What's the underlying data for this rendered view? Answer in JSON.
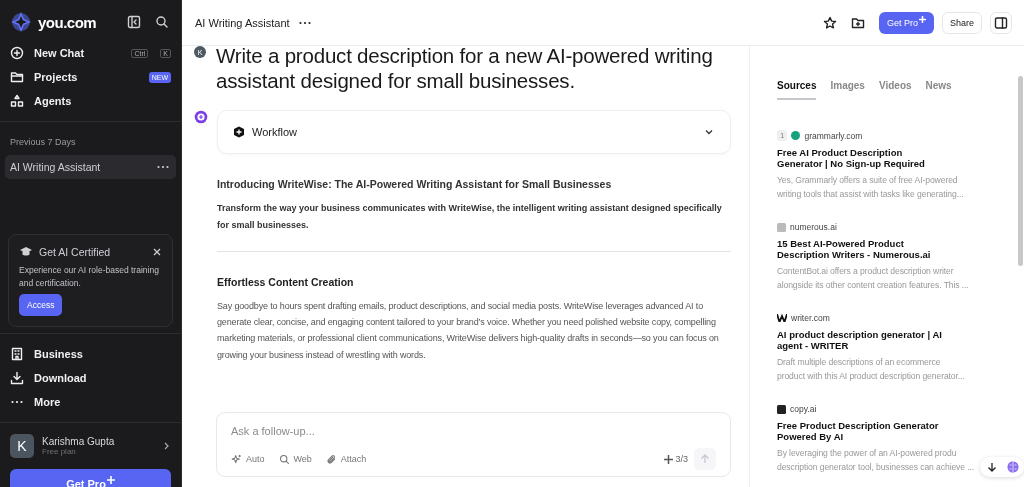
{
  "sidebar": {
    "brand": "you.com",
    "nav": [
      {
        "kind": "new",
        "label": "New Chat",
        "keys": [
          "Ctrl",
          "K"
        ]
      },
      {
        "kind": "projects",
        "label": "Projects",
        "badge": "NEW"
      },
      {
        "kind": "agents",
        "label": "Agents"
      }
    ],
    "history_heading": "Previous 7 Days",
    "history": [
      {
        "label": "AI Writing Assistant",
        "selected": true
      }
    ],
    "promo": {
      "title": "Get AI Certified",
      "text": "Experience our AI role-based training and certification.",
      "button": "Access"
    },
    "bottom_nav": [
      {
        "kind": "business",
        "label": "Business"
      },
      {
        "kind": "download",
        "label": "Download"
      },
      {
        "kind": "more",
        "label": "More"
      }
    ],
    "user": {
      "initial": "K",
      "name": "Karishma Gupta",
      "plan": "Free plan"
    },
    "upgrade": "Get Pro"
  },
  "header": {
    "title": "AI Writing Assistant",
    "button_primary": "Get Pro",
    "button_share": "Share"
  },
  "chat": {
    "user_initial": "K",
    "question": "Write a product description for a new AI-powered writing assistant designed for small businesses.",
    "workflow": {
      "label": "Workflow",
      "expanded": false
    },
    "answer": [
      {
        "kind": "heading",
        "text": "Introducing WriteWise: The AI-Powered Writing Assistant for Small Businesses"
      },
      {
        "kind": "lead",
        "text": "Transform the way your business communicates with WriteWise, the intelligent writing assistant designed specifically for small businesses."
      },
      {
        "kind": "rule"
      },
      {
        "kind": "subheading",
        "text": "Effortless Content Creation"
      },
      {
        "kind": "paragraph",
        "text": "Say goodbye to hours spent drafting emails, product descriptions, and social media posts. WriteWise leverages advanced AI to generate clear, concise, and engaging content tailored to your brand’s voice. Whether you need polished website copy, compelling marketing materials, or professional client communications, WriteWise delivers high-quality drafts in seconds—so you can focus on growing your business instead of wrestling with words."
      }
    ]
  },
  "composer": {
    "placeholder": "Ask a follow-up...",
    "tools": [
      {
        "kind": "auto",
        "label": "Auto"
      },
      {
        "kind": "web",
        "label": "Web"
      },
      {
        "kind": "attach",
        "label": "Attach"
      }
    ],
    "quota": "3/3"
  },
  "sources_panel": {
    "tabs": [
      {
        "label": "Sources",
        "selected": true
      },
      {
        "label": "Images",
        "selected": false
      },
      {
        "label": "Videos",
        "selected": false
      },
      {
        "label": "News",
        "selected": false
      }
    ],
    "sources": [
      {
        "index": "1",
        "site": "grammarly.com",
        "kind": "circle",
        "color": "#15a37f",
        "title": "Free AI Product Description Generator | No Sign-up Required",
        "snippet": [
          "Yes, Grammarly offers a suite of free AI-powered",
          "writing tools that assist with tasks like generating..."
        ]
      },
      {
        "site": "numerous.ai",
        "kind": "square",
        "color": "#bbbbbb",
        "title": "15 Best AI-Powered Product Description Writers - Numerous.ai",
        "snippet": [
          "ContentBot.ai offers a product description writer",
          "alongside its other content creation features. This ..."
        ]
      },
      {
        "site": "writer.com",
        "kind": "w",
        "color": "#111111",
        "title": "AI product description generator | AI agent - WRITER",
        "snippet": [
          "Draft multiple descriptions of an ecommerce",
          "product with this AI product description generator..."
        ]
      },
      {
        "site": "copy.ai",
        "kind": "square",
        "color": "#222222",
        "title": "Free Product Description Generator Powered By AI",
        "snippet": [
          "By leveraging the power of an AI-powered produ",
          "description generator tool, businesses can achieve ..."
        ]
      }
    ]
  }
}
